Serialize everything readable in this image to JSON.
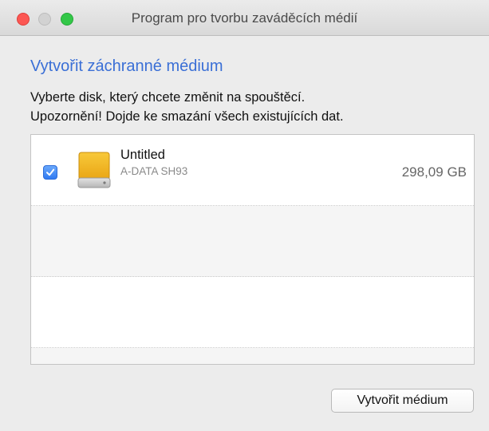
{
  "window": {
    "title": "Program pro tvorbu zaváděcích médií",
    "controls": [
      "close",
      "minimize",
      "zoom"
    ]
  },
  "heading": "Vytvořit záchranné médium",
  "description": {
    "line1": "Vyberte disk, který chcete změnit na spouštěcí.",
    "line2": "Upozornění! Dojde ke smazání všech existujících dat."
  },
  "disks": [
    {
      "name": "Untitled",
      "model": "A-DATA SH93",
      "size": "298,09 GB",
      "checked": true,
      "icon": "hard-drive-icon"
    }
  ],
  "actions": {
    "create_label": "Vytvořit médium"
  },
  "colors": {
    "accent": "#3a6fd6",
    "checkbox": "#2f7af2",
    "close": "#fc5753",
    "zoom": "#33c748"
  }
}
